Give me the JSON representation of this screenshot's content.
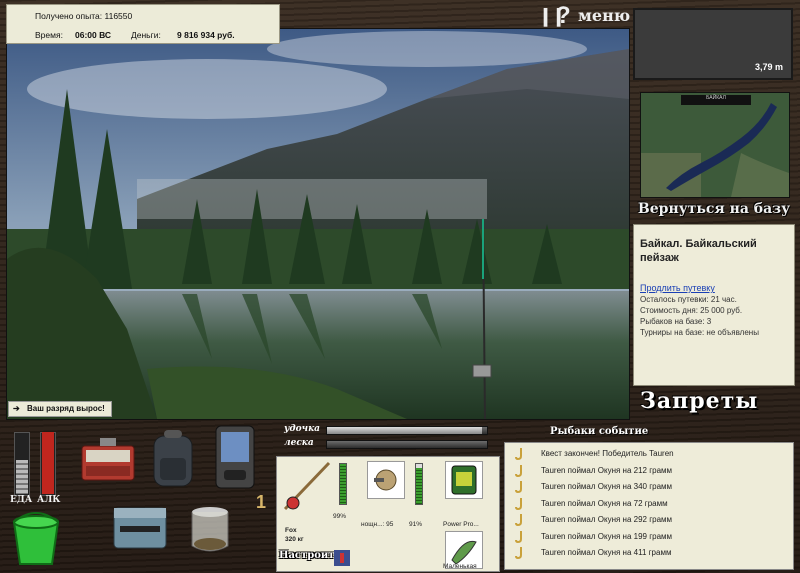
{
  "header": {
    "experience_label": "Получено опыта:",
    "experience_value": "116550",
    "time_label": "Время:",
    "time_value": "06:00 ВС",
    "money_label": "Деньги:",
    "money_value": "9 816 934 руб.",
    "pause_icon": "pause-icon",
    "help_icon": "question-icon",
    "menu_label": "меню"
  },
  "depth": {
    "value": "3,79 m"
  },
  "map": {
    "title": "БАЙКАЛ"
  },
  "return_label": "Вернуться на базу",
  "location": {
    "name": "Байкал. Байкальский пейзаж",
    "extend_link": "Продлить путевку",
    "remaining": "Осталось путевки: 21 час.",
    "day_cost": "Стоимость дня: 25 000 руб.",
    "fishers": "Рыбаков на базе: 3",
    "tournaments": "Турниры на базе: не объявлены"
  },
  "bans_label": "Запреты",
  "rank_message": "Ваш разряд вырос!",
  "gauges": {
    "food_label": "ЕДА",
    "alc_label": "АЛК",
    "food_level": 0.55,
    "alc_level": 1.0
  },
  "inventory": {
    "count_label": "1"
  },
  "bars": {
    "rod_label": "удочка",
    "line_label": "леска",
    "rod_level": 0.97,
    "line_level": 0.0
  },
  "tackle": {
    "rod_name": "Fox",
    "rod_weight": "320 кг",
    "rod_percent": "99%",
    "rod_level": 0.99,
    "reel_name": "нощн...: 95",
    "reel_percent": "91%",
    "reel_level": 0.91,
    "line_name": "Power Pro...",
    "lure_name": "Маленькая",
    "setup_label": "Настроить"
  },
  "events": {
    "title": "Рыбаки событие",
    "items": [
      "Квест закончен! Победитель Tauren",
      "Tauren поймал Окуня на 212 грамм",
      "Tauren поймал Окуня на 340 грамм",
      "Tauren поймал Окуня на 72 грамм",
      "Tauren поймал Окуня на 292 грамм",
      "Tauren поймал Окуня на 199 грамм",
      "Tauren поймал Окуня на 411 грамм"
    ]
  }
}
